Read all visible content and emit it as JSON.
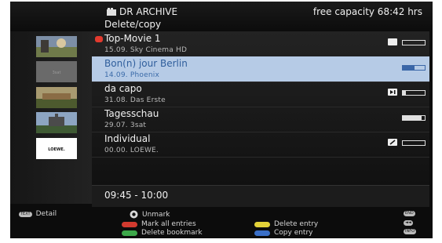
{
  "header": {
    "title": "DR ARCHIVE",
    "subtitle": "Delete/copy",
    "capacity": "free capacity 68:42 hrs"
  },
  "entries": [
    {
      "name": "Top-Movie 1",
      "meta": "15.09.   Sky Cinema HD",
      "selected": false,
      "marked": true,
      "progress": 0.0,
      "icon": "pin-icon"
    },
    {
      "name": "Bon(n) jour Berlin",
      "meta": "14.09.   Phoenix",
      "selected": true,
      "marked": false,
      "progress": 0.55,
      "icon": ""
    },
    {
      "name": "da capo",
      "meta": "31.08.   Das Erste",
      "selected": false,
      "marked": false,
      "progress": 0.15,
      "icon": "play-next-icon"
    },
    {
      "name": "Tagesschau",
      "meta": "29.07.   3sat",
      "selected": false,
      "marked": false,
      "progress": 0.85,
      "icon": ""
    },
    {
      "name": "Individual",
      "meta": "00.00.   LOEWE.",
      "selected": false,
      "marked": false,
      "progress": 0.0,
      "icon": "edit-icon"
    }
  ],
  "thumbnails": [
    {
      "label": ""
    },
    {
      "label": "3sat"
    },
    {
      "label": ""
    },
    {
      "label": ""
    },
    {
      "label": "LOEWE."
    }
  ],
  "time_range": "09:45 - 10:00",
  "footer": {
    "detail_key": "TEXT",
    "detail": "Detail",
    "unmark": "Unmark",
    "mark_all": "Mark all entries",
    "delete_bookmark": "Delete bookmark",
    "delete_entry": "Delete entry",
    "copy_entry": "Copy entry",
    "end_key": "END",
    "rew_key": "◄◄",
    "info_key": "INFO"
  },
  "colors": {
    "red": "#d23a2f",
    "green": "#3da84a",
    "yellow": "#e3d238",
    "blue": "#3a6fc7",
    "selected_row": "#b6cbe6"
  }
}
